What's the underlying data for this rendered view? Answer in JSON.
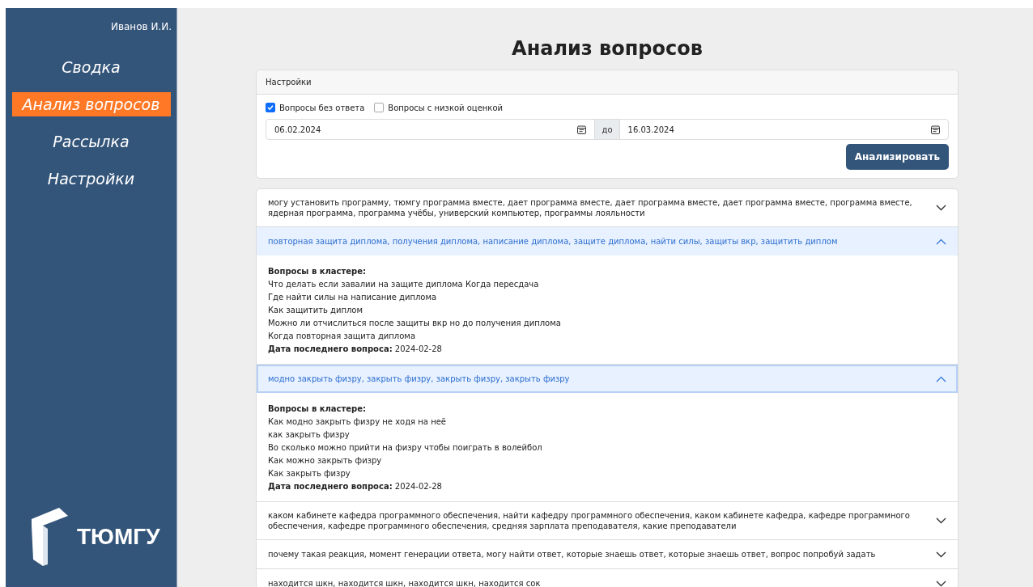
{
  "user": "Иванов И.И.",
  "nav": [
    {
      "label": "Сводка",
      "selected": false
    },
    {
      "label": "Анализ вопросов",
      "selected": true
    },
    {
      "label": "Рассылка",
      "selected": false
    },
    {
      "label": "Настройки",
      "selected": false
    }
  ],
  "logo": {
    "text": "ТЮМГУ"
  },
  "title": "Анализ вопросов",
  "settings": {
    "header": "Настройки",
    "checkboxes": [
      {
        "label": "Вопросы без ответа",
        "checked": true
      },
      {
        "label": "Вопросы с низкой оценкой",
        "checked": false
      }
    ],
    "date_from": "06.02.2024",
    "date_sep": "до",
    "date_to": "16.03.2024",
    "button": "Анализировать"
  },
  "clusters": [
    {
      "title": "могу установить программу, тюмгу программа вместе, дает программа вместе, дает программа вместе, дает программа вместе, программа вместе, ядерная программа, программа учёбы, универский компьютер, программы лояльности",
      "expanded": false,
      "focused": false
    },
    {
      "title": "повторная защита диплома, получения диплома, написание диплома, защите диплома, найти силы, защиты вкр, защитить диплом",
      "expanded": true,
      "focused": false,
      "questions_label": "Вопросы в кластере:",
      "questions": [
        "Что делать если завалии на защите диплома Когда пересдача",
        "Где найти силы на написание диплома",
        "Как защитить диплом",
        "Можно ли отчислиться после защиты вкр но до получения диплома",
        "Когда повторная защита диплома"
      ],
      "date_label": "Дата последнего вопроса:",
      "date": "2024-02-28"
    },
    {
      "title": "модно закрыть физру, закрыть физру, закрыть физру, закрыть физру",
      "expanded": true,
      "focused": true,
      "questions_label": "Вопросы в кластере:",
      "questions": [
        "Как модно закрыть физру не ходя на неё",
        "как закрыть физру",
        "Во сколько можно прийти на физру чтобы поиграть в волейбол",
        "Как можно закрыть физру",
        "Как закрыть физру"
      ],
      "date_label": "Дата последнего вопроса:",
      "date": "2024-02-28"
    },
    {
      "title": "каком кабинете кафедра программного обеспечения, найти кафедру программного обеспечения, каком кабинете кафедра, кафедре программного обеспечения, кафедре программного обеспечения, средняя зарплата преподавателя, какие преподаватели",
      "expanded": false,
      "focused": false
    },
    {
      "title": "почему такая реакция, момент генерации ответа, могу найти ответ, которые знаешь ответ, которые знаешь ответ, вопрос попробуй задать",
      "expanded": false,
      "focused": false
    },
    {
      "title": "находится шкн, находится шкн, находится шкн, находится сок",
      "expanded": false,
      "focused": false
    }
  ]
}
